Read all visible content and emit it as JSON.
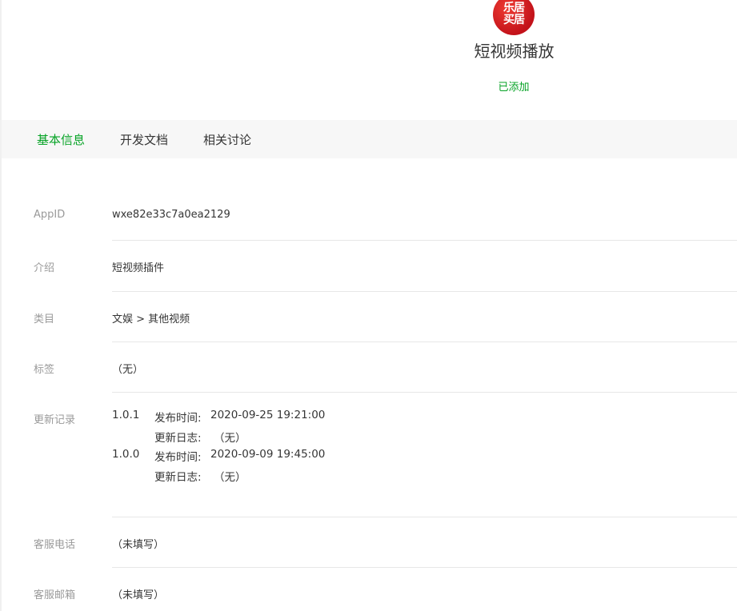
{
  "plugin": {
    "logo_lines": [
      "乐居",
      "买居"
    ],
    "title": "短视频播放",
    "status": "已添加"
  },
  "tabs": [
    "基本信息",
    "开发文档",
    "相关讨论"
  ],
  "info": {
    "appid_label": "AppID",
    "appid_value": "wxe82e33c7a0ea2129",
    "intro_label": "介绍",
    "intro_value": "短视频插件",
    "category_label": "类目",
    "category_value": "文娱 > 其他视频",
    "tags_label": "标签",
    "tags_value": "（无）",
    "changelog_label": "更新记录",
    "versions": [
      {
        "version": "1.0.1",
        "time_label": "发布时间:",
        "time": "2020-09-25 19:21:00",
        "log_label": "更新日志:",
        "log": "（无）"
      },
      {
        "version": "1.0.0",
        "time_label": "发布时间:",
        "time": "2020-09-09 19:45:00",
        "log_label": "更新日志:",
        "log": "（无）"
      }
    ],
    "phone_label": "客服电话",
    "phone_value": "（未填写）",
    "email_label": "客服邮箱",
    "email_value": "（未填写）"
  }
}
